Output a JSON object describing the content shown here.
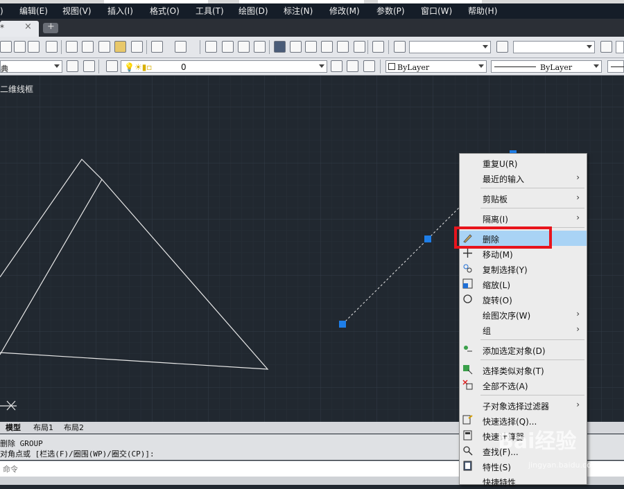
{
  "menubar": {
    "items": [
      "编辑(E)",
      "视图(V)",
      "插入(I)",
      "格式(O)",
      "工具(T)",
      "绘图(D)",
      "标注(N)",
      "修改(M)",
      "参数(P)",
      "窗口(W)",
      "帮助(H)"
    ],
    "partial_left": ")"
  },
  "tabs": {
    "active_marker": "*",
    "close_glyph": "×"
  },
  "toolbar2": {
    "workspace_fragment": "典",
    "layer_value": "0",
    "color_value": "ByLayer",
    "linetype_value": "ByLayer"
  },
  "drawing": {
    "view_label": "二维线框"
  },
  "layout_tabs": [
    "模型",
    "布局1",
    "布局2"
  ],
  "command": {
    "history": [
      "删除 GROUP",
      "对角点或 [栏选(F)/圈围(WP)/圈交(CP)]:"
    ],
    "input_placeholder": "命令"
  },
  "context_menu": {
    "items": [
      {
        "label": "重复U(R)",
        "submenu": false,
        "icon": ""
      },
      {
        "label": "最近的输入",
        "submenu": true,
        "icon": ""
      },
      {
        "label": "剪贴板",
        "submenu": true,
        "icon": ""
      },
      {
        "label": "隔离(I)",
        "submenu": true,
        "icon": ""
      },
      {
        "label": "删除",
        "submenu": false,
        "icon": "eraser-icon",
        "highlighted": true
      },
      {
        "label": "移动(M)",
        "submenu": false,
        "icon": "move-icon"
      },
      {
        "label": "复制选择(Y)",
        "submenu": false,
        "icon": "copy-icon"
      },
      {
        "label": "缩放(L)",
        "submenu": false,
        "icon": "scale-icon"
      },
      {
        "label": "旋转(O)",
        "submenu": false,
        "icon": "rotate-icon"
      },
      {
        "label": "绘图次序(W)",
        "submenu": true,
        "icon": ""
      },
      {
        "label": "组",
        "submenu": true,
        "icon": ""
      },
      {
        "label": "添加选定对象(D)",
        "submenu": false,
        "icon": "add-selected-icon"
      },
      {
        "label": "选择类似对象(T)",
        "submenu": false,
        "icon": "select-similar-icon"
      },
      {
        "label": "全部不选(A)",
        "submenu": false,
        "icon": "deselect-all-icon"
      },
      {
        "label": "子对象选择过滤器",
        "submenu": true,
        "icon": ""
      },
      {
        "label": "快速选择(Q)...",
        "submenu": false,
        "icon": "quick-select-icon"
      },
      {
        "label": "快速计算器",
        "submenu": false,
        "icon": "calculator-icon"
      },
      {
        "label": "查找(F)...",
        "submenu": false,
        "icon": "find-icon"
      },
      {
        "label": "特性(S)",
        "submenu": false,
        "icon": "properties-icon"
      },
      {
        "label": "快捷特性",
        "submenu": false,
        "icon": ""
      }
    ],
    "submenu_glyph": "›"
  },
  "watermark": {
    "text": "Bai经验",
    "url": "jingyan.baidu.com"
  }
}
